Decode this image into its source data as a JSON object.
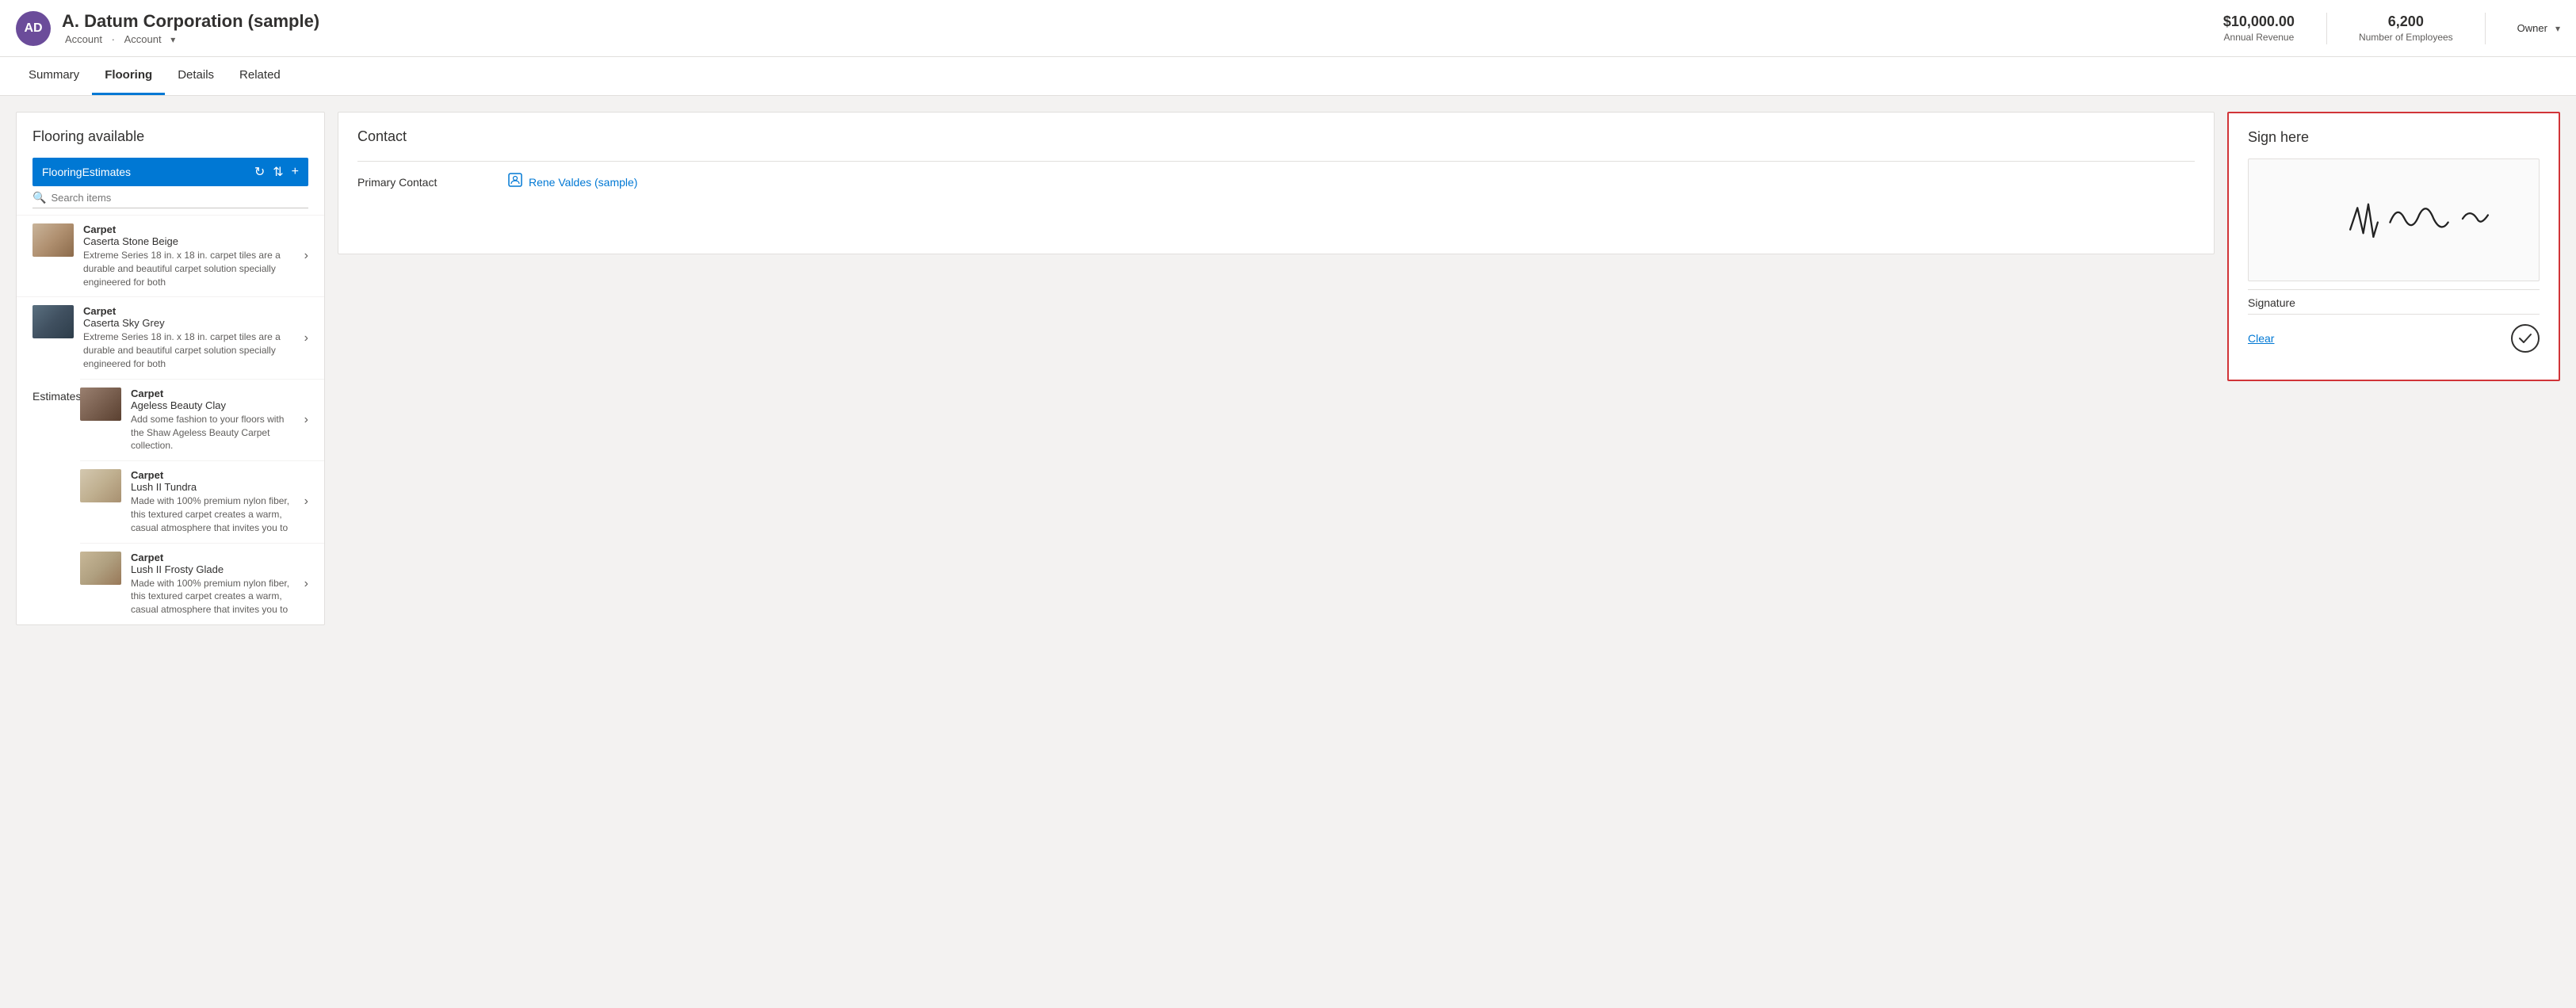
{
  "header": {
    "avatar_initials": "AD",
    "title": "A. Datum Corporation (sample)",
    "breadcrumb1": "Account",
    "breadcrumb2": "Account",
    "annual_revenue_label": "Annual Revenue",
    "annual_revenue_value": "$10,000.00",
    "employees_label": "Number of Employees",
    "employees_value": "6,200",
    "owner_label": "Owner"
  },
  "nav": {
    "tabs": [
      {
        "id": "summary",
        "label": "Summary",
        "active": false
      },
      {
        "id": "flooring",
        "label": "Flooring",
        "active": true
      },
      {
        "id": "details",
        "label": "Details",
        "active": false
      },
      {
        "id": "related",
        "label": "Related",
        "active": false
      }
    ]
  },
  "flooring_panel": {
    "title": "Flooring available",
    "estimates_label": "Estimates",
    "subheader_label": "FlooringEstimates",
    "search_placeholder": "Search items",
    "items": [
      {
        "type": "Carpet",
        "name": "Caserta Stone Beige",
        "desc": "Extreme Series 18 in. x 18 in. carpet tiles are a durable and beautiful carpet solution specially engineered for both",
        "swatch": "swatch-caserta-beige"
      },
      {
        "type": "Carpet",
        "name": "Caserta Sky Grey",
        "desc": "Extreme Series 18 in. x 18 in. carpet tiles are a durable and beautiful carpet solution specially engineered for both",
        "swatch": "swatch-caserta-grey"
      },
      {
        "type": "Carpet",
        "name": "Ageless Beauty Clay",
        "desc": "Add some fashion to your floors with the Shaw Ageless Beauty Carpet collection.",
        "swatch": "swatch-ageless-clay"
      },
      {
        "type": "Carpet",
        "name": "Lush II Tundra",
        "desc": "Made with 100% premium nylon fiber, this textured carpet creates a warm, casual atmosphere that invites you to",
        "swatch": "swatch-lush-tundra"
      },
      {
        "type": "Carpet",
        "name": "Lush II Frosty Glade",
        "desc": "Made with 100% premium nylon fiber, this textured carpet creates a warm, casual atmosphere that invites you to",
        "swatch": "swatch-lush-frosty"
      }
    ]
  },
  "contact_panel": {
    "title": "Contact",
    "primary_contact_label": "Primary Contact",
    "primary_contact_value": "Rene Valdes (sample)"
  },
  "sign_panel": {
    "title": "Sign here",
    "signature_label": "Signature",
    "clear_label": "Clear"
  }
}
